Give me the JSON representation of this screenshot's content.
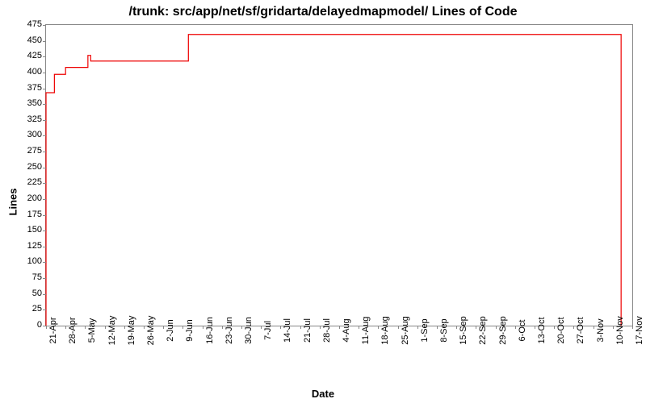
{
  "chart_data": {
    "type": "line",
    "title": "/trunk: src/app/net/sf/gridarta/delayedmapmodel/ Lines of Code",
    "xlabel": "Date",
    "ylabel": "Lines",
    "ylim": [
      0,
      475
    ],
    "y_ticks": [
      0,
      25,
      50,
      75,
      100,
      125,
      150,
      175,
      200,
      225,
      250,
      275,
      300,
      325,
      350,
      375,
      400,
      425,
      450,
      475
    ],
    "x_ticks": [
      "21-Apr",
      "28-Apr",
      "5-May",
      "12-May",
      "19-May",
      "26-May",
      "2-Jun",
      "9-Jun",
      "16-Jun",
      "23-Jun",
      "30-Jun",
      "7-Jul",
      "14-Jul",
      "21-Jul",
      "28-Jul",
      "4-Aug",
      "11-Aug",
      "18-Aug",
      "25-Aug",
      "1-Sep",
      "8-Sep",
      "15-Sep",
      "22-Sep",
      "29-Sep",
      "6-Oct",
      "13-Oct",
      "20-Oct",
      "27-Oct",
      "3-Nov",
      "10-Nov",
      "17-Nov"
    ],
    "series": [
      {
        "name": "Lines of Code",
        "color": "#ee0000",
        "points": [
          {
            "x": "21-Apr",
            "y": 0
          },
          {
            "x": "21-Apr",
            "y": 368
          },
          {
            "x": "24-Apr",
            "y": 368
          },
          {
            "x": "24-Apr",
            "y": 397
          },
          {
            "x": "28-Apr",
            "y": 397
          },
          {
            "x": "28-Apr",
            "y": 408
          },
          {
            "x": "6-May",
            "y": 408
          },
          {
            "x": "6-May",
            "y": 427
          },
          {
            "x": "7-May",
            "y": 427
          },
          {
            "x": "7-May",
            "y": 418
          },
          {
            "x": "11-Jun",
            "y": 418
          },
          {
            "x": "11-Jun",
            "y": 460
          },
          {
            "x": "13-Nov",
            "y": 460
          },
          {
            "x": "13-Nov",
            "y": 0
          }
        ]
      }
    ]
  }
}
